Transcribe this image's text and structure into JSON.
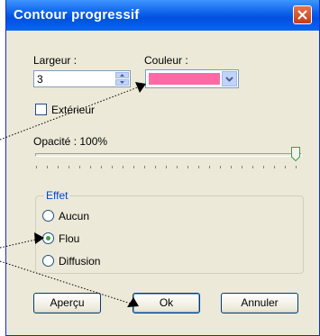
{
  "dialog": {
    "title": "Contour progressif"
  },
  "width_field": {
    "label": "Largeur :",
    "value": "3"
  },
  "color_field": {
    "label": "Couleur :",
    "value": "#ff6aa6"
  },
  "exterior_checkbox": {
    "label": "Extérieur",
    "checked": false
  },
  "opacity": {
    "label": "Opacité : 100%",
    "value_percent": 100
  },
  "effect_group": {
    "legend": "Effet",
    "options": [
      {
        "label": "Aucun",
        "selected": false
      },
      {
        "label": "Flou",
        "selected": true
      },
      {
        "label": "Diffusion",
        "selected": false
      }
    ]
  },
  "buttons": {
    "preview": "Aperçu",
    "ok": "Ok",
    "cancel": "Annuler"
  },
  "icons": {
    "close": "close-icon",
    "spin_up": "spin-up-arrow-icon",
    "spin_down": "spin-down-arrow-icon",
    "dropdown": "chevron-down-icon",
    "slider": "slider-thumb-icon"
  },
  "colors": {
    "title_bar": "#0a5ee8",
    "close_button": "#c63c18",
    "dialog_background": "#ece9d8",
    "group_legend_text": "#0046d5",
    "radio_selected": "#3ba13f"
  }
}
